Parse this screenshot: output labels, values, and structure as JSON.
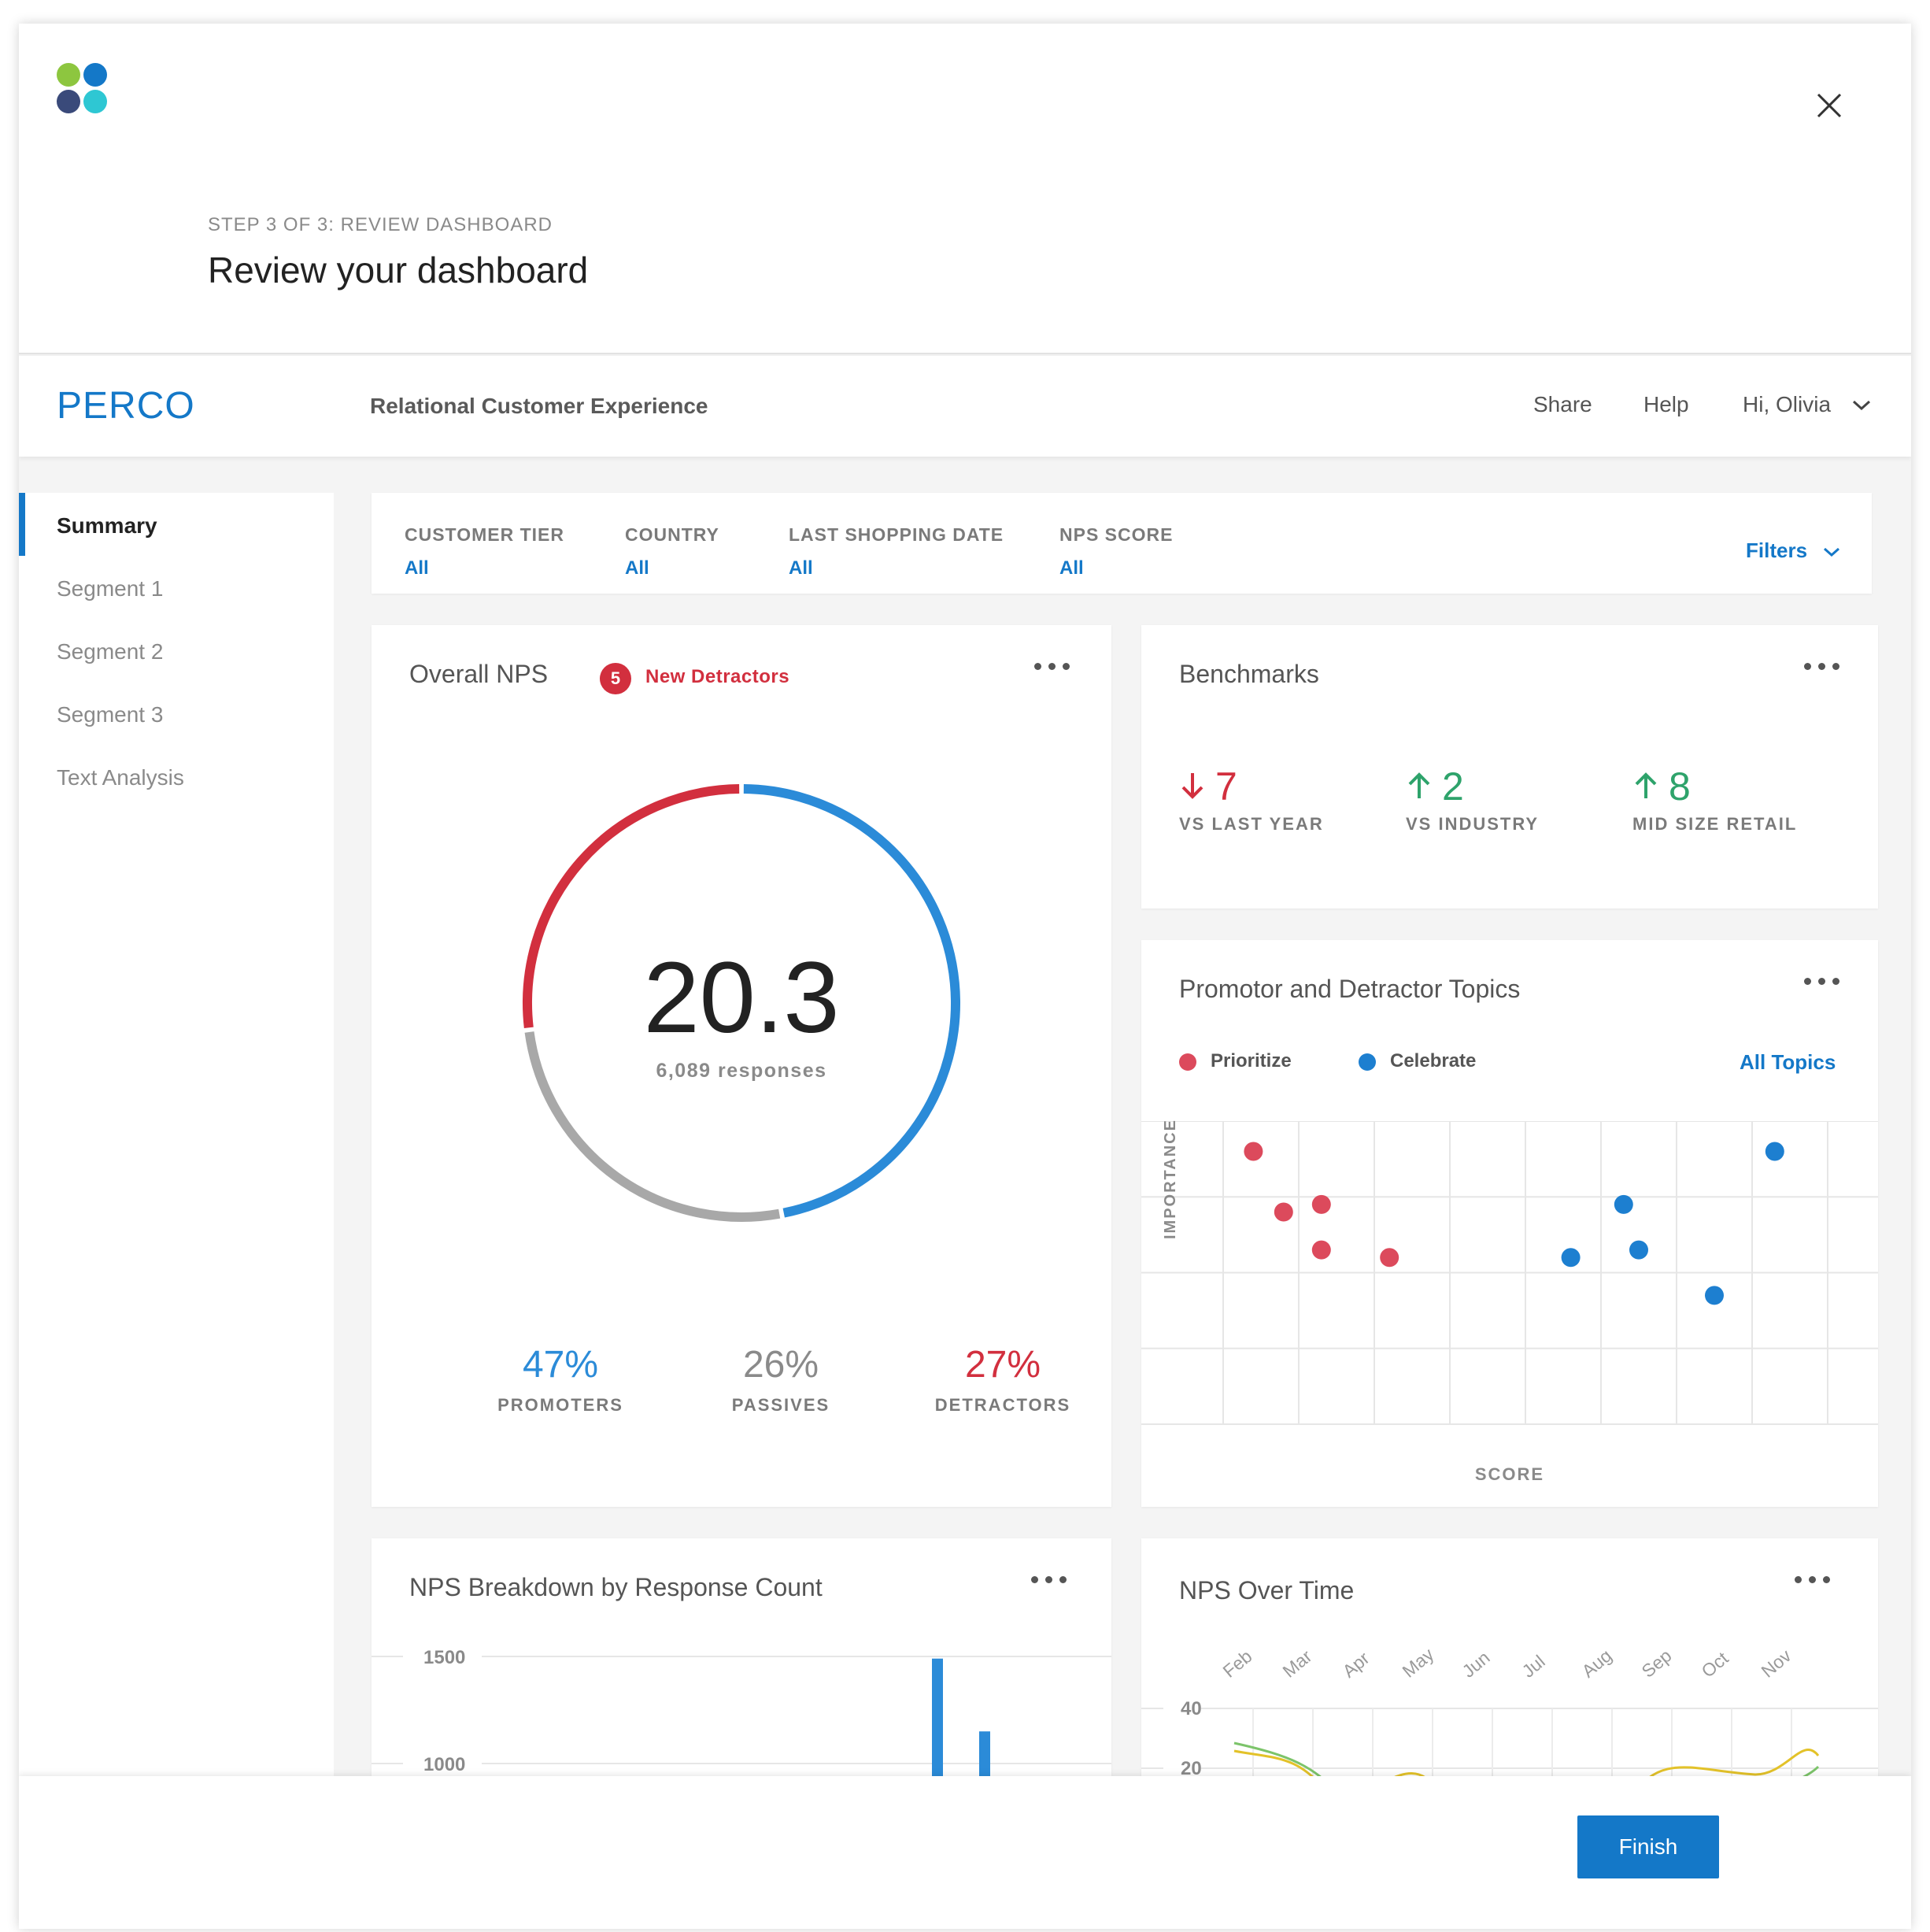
{
  "wizard": {
    "step_label": "STEP 3 OF 3: REVIEW DASHBOARD",
    "title": "Review your dashboard",
    "finish_label": "Finish"
  },
  "app": {
    "brand": "PERCO",
    "name": "Relational Customer Experience",
    "nav": {
      "share": "Share",
      "help": "Help",
      "user": "Hi, Olivia"
    }
  },
  "colors": {
    "accent": "#1478c8",
    "red": "#d22f3e",
    "green": "#2ea36b",
    "grey": "#a8a8a8",
    "blue_series": "#2b8bd8",
    "yellow_series": "#e3c229",
    "green_series": "#7cc46a"
  },
  "sidebar": {
    "items": [
      {
        "label": "Summary",
        "active": true
      },
      {
        "label": "Segment 1"
      },
      {
        "label": "Segment 2"
      },
      {
        "label": "Segment 3"
      },
      {
        "label": "Text Analysis"
      }
    ]
  },
  "filters": {
    "items": [
      {
        "label": "CUSTOMER TIER",
        "value": "All"
      },
      {
        "label": "COUNTRY",
        "value": "All"
      },
      {
        "label": "LAST SHOPPING DATE",
        "value": "All"
      },
      {
        "label": "NPS SCORE",
        "value": "All"
      }
    ],
    "button_label": "Filters"
  },
  "overall_nps": {
    "title": "Overall NPS",
    "badge_count": "5",
    "badge_label": "New Detractors",
    "value": "20.3",
    "responses": "6,089 responses",
    "promoters": {
      "value": "47%",
      "label": "PROMOTERS"
    },
    "passives": {
      "value": "26%",
      "label": "PASSIVES"
    },
    "detractors": {
      "value": "27%",
      "label": "DETRACTORS"
    }
  },
  "benchmarks": {
    "title": "Benchmarks",
    "items": [
      {
        "direction": "down",
        "value": "7",
        "label": "VS LAST YEAR"
      },
      {
        "direction": "up",
        "value": "2",
        "label": "VS INDUSTRY"
      },
      {
        "direction": "up",
        "value": "8",
        "label": "MID SIZE RETAIL"
      }
    ]
  },
  "topics": {
    "title": "Promotor and Detractor Topics",
    "legend": [
      {
        "label": "Prioritize"
      },
      {
        "label": "Celebrate"
      }
    ],
    "all_topics_label": "All Topics",
    "x_label": "SCORE",
    "y_label": "IMPORTANCE"
  },
  "breakdown": {
    "title": "NPS Breakdown by Response Count"
  },
  "over_time": {
    "title": "NPS Over Time"
  },
  "chart_data": [
    {
      "type": "pie",
      "title": "Overall NPS",
      "categories": [
        "Promoters",
        "Passives",
        "Detractors"
      ],
      "values": [
        47,
        26,
        27
      ]
    },
    {
      "type": "scatter",
      "title": "Promotor and Detractor Topics",
      "xlabel": "SCORE",
      "ylabel": "IMPORTANCE",
      "xlim": [
        0,
        9.4
      ],
      "ylim": [
        0,
        4
      ],
      "grid": true,
      "series": [
        {
          "name": "Prioritize",
          "points": [
            [
              1.4,
              3.6
            ],
            [
              1.8,
              2.8
            ],
            [
              2.3,
              2.9
            ],
            [
              2.3,
              2.3
            ],
            [
              3.2,
              2.2
            ]
          ]
        },
        {
          "name": "Celebrate",
          "points": [
            [
              5.6,
              2.2
            ],
            [
              6.3,
              2.9
            ],
            [
              6.5,
              2.3
            ],
            [
              7.5,
              1.7
            ],
            [
              8.3,
              3.6
            ]
          ]
        }
      ]
    },
    {
      "type": "bar",
      "title": "NPS Breakdown by Response Count",
      "yticks": [
        1500,
        1000
      ],
      "ylim": [
        0,
        1500
      ],
      "values": [
        1490,
        1150
      ]
    },
    {
      "type": "line",
      "title": "NPS Over Time",
      "categories": [
        "Feb",
        "Mar",
        "Apr",
        "May",
        "Jun",
        "Jul",
        "Aug",
        "Sep",
        "Oct",
        "Nov"
      ],
      "yticks": [
        40,
        20
      ]
    }
  ]
}
